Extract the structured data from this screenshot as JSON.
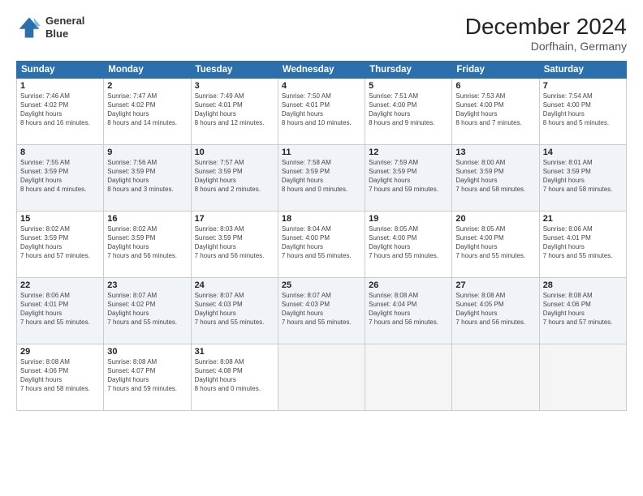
{
  "header": {
    "logo_line1": "General",
    "logo_line2": "Blue",
    "month": "December 2024",
    "location": "Dorfhain, Germany"
  },
  "weekdays": [
    "Sunday",
    "Monday",
    "Tuesday",
    "Wednesday",
    "Thursday",
    "Friday",
    "Saturday"
  ],
  "weeks": [
    [
      {
        "day": 1,
        "sunrise": "7:46 AM",
        "sunset": "4:02 PM",
        "daylight": "8 hours and 16 minutes."
      },
      {
        "day": 2,
        "sunrise": "7:47 AM",
        "sunset": "4:02 PM",
        "daylight": "8 hours and 14 minutes."
      },
      {
        "day": 3,
        "sunrise": "7:49 AM",
        "sunset": "4:01 PM",
        "daylight": "8 hours and 12 minutes."
      },
      {
        "day": 4,
        "sunrise": "7:50 AM",
        "sunset": "4:01 PM",
        "daylight": "8 hours and 10 minutes."
      },
      {
        "day": 5,
        "sunrise": "7:51 AM",
        "sunset": "4:00 PM",
        "daylight": "8 hours and 9 minutes."
      },
      {
        "day": 6,
        "sunrise": "7:53 AM",
        "sunset": "4:00 PM",
        "daylight": "8 hours and 7 minutes."
      },
      {
        "day": 7,
        "sunrise": "7:54 AM",
        "sunset": "4:00 PM",
        "daylight": "8 hours and 5 minutes."
      }
    ],
    [
      {
        "day": 8,
        "sunrise": "7:55 AM",
        "sunset": "3:59 PM",
        "daylight": "8 hours and 4 minutes."
      },
      {
        "day": 9,
        "sunrise": "7:56 AM",
        "sunset": "3:59 PM",
        "daylight": "8 hours and 3 minutes."
      },
      {
        "day": 10,
        "sunrise": "7:57 AM",
        "sunset": "3:59 PM",
        "daylight": "8 hours and 2 minutes."
      },
      {
        "day": 11,
        "sunrise": "7:58 AM",
        "sunset": "3:59 PM",
        "daylight": "8 hours and 0 minutes."
      },
      {
        "day": 12,
        "sunrise": "7:59 AM",
        "sunset": "3:59 PM",
        "daylight": "7 hours and 59 minutes."
      },
      {
        "day": 13,
        "sunrise": "8:00 AM",
        "sunset": "3:59 PM",
        "daylight": "7 hours and 58 minutes."
      },
      {
        "day": 14,
        "sunrise": "8:01 AM",
        "sunset": "3:59 PM",
        "daylight": "7 hours and 58 minutes."
      }
    ],
    [
      {
        "day": 15,
        "sunrise": "8:02 AM",
        "sunset": "3:59 PM",
        "daylight": "7 hours and 57 minutes."
      },
      {
        "day": 16,
        "sunrise": "8:02 AM",
        "sunset": "3:59 PM",
        "daylight": "7 hours and 56 minutes."
      },
      {
        "day": 17,
        "sunrise": "8:03 AM",
        "sunset": "3:59 PM",
        "daylight": "7 hours and 56 minutes."
      },
      {
        "day": 18,
        "sunrise": "8:04 AM",
        "sunset": "4:00 PM",
        "daylight": "7 hours and 55 minutes."
      },
      {
        "day": 19,
        "sunrise": "8:05 AM",
        "sunset": "4:00 PM",
        "daylight": "7 hours and 55 minutes."
      },
      {
        "day": 20,
        "sunrise": "8:05 AM",
        "sunset": "4:00 PM",
        "daylight": "7 hours and 55 minutes."
      },
      {
        "day": 21,
        "sunrise": "8:06 AM",
        "sunset": "4:01 PM",
        "daylight": "7 hours and 55 minutes."
      }
    ],
    [
      {
        "day": 22,
        "sunrise": "8:06 AM",
        "sunset": "4:01 PM",
        "daylight": "7 hours and 55 minutes."
      },
      {
        "day": 23,
        "sunrise": "8:07 AM",
        "sunset": "4:02 PM",
        "daylight": "7 hours and 55 minutes."
      },
      {
        "day": 24,
        "sunrise": "8:07 AM",
        "sunset": "4:03 PM",
        "daylight": "7 hours and 55 minutes."
      },
      {
        "day": 25,
        "sunrise": "8:07 AM",
        "sunset": "4:03 PM",
        "daylight": "7 hours and 55 minutes."
      },
      {
        "day": 26,
        "sunrise": "8:08 AM",
        "sunset": "4:04 PM",
        "daylight": "7 hours and 56 minutes."
      },
      {
        "day": 27,
        "sunrise": "8:08 AM",
        "sunset": "4:05 PM",
        "daylight": "7 hours and 56 minutes."
      },
      {
        "day": 28,
        "sunrise": "8:08 AM",
        "sunset": "4:06 PM",
        "daylight": "7 hours and 57 minutes."
      }
    ],
    [
      {
        "day": 29,
        "sunrise": "8:08 AM",
        "sunset": "4:06 PM",
        "daylight": "7 hours and 58 minutes."
      },
      {
        "day": 30,
        "sunrise": "8:08 AM",
        "sunset": "4:07 PM",
        "daylight": "7 hours and 59 minutes."
      },
      {
        "day": 31,
        "sunrise": "8:08 AM",
        "sunset": "4:08 PM",
        "daylight": "8 hours and 0 minutes."
      },
      null,
      null,
      null,
      null
    ]
  ]
}
